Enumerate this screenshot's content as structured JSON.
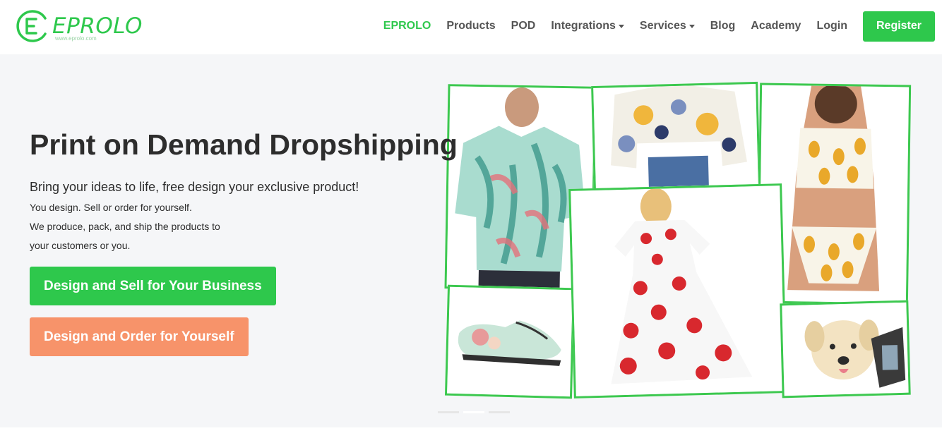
{
  "brand": {
    "name": "EPROLO",
    "url_text": "www.eprolo.com",
    "color": "#2ec84c"
  },
  "nav": {
    "items": [
      {
        "label": "EPROLO",
        "active": true,
        "dropdown": false
      },
      {
        "label": "Products",
        "active": false,
        "dropdown": false
      },
      {
        "label": "POD",
        "active": false,
        "dropdown": false
      },
      {
        "label": "Integrations",
        "active": false,
        "dropdown": true
      },
      {
        "label": "Services",
        "active": false,
        "dropdown": true
      },
      {
        "label": "Blog",
        "active": false,
        "dropdown": false
      },
      {
        "label": "Academy",
        "active": false,
        "dropdown": false
      },
      {
        "label": "Login",
        "active": false,
        "dropdown": false
      }
    ],
    "register_label": "Register"
  },
  "hero": {
    "title": "Print on Demand Dropshipping",
    "lead": "Bring your ideas to life, free design your exclusive product!",
    "lines": [
      "You design. Sell or order for yourself.",
      "We produce, pack, and ship the products to",
      "your customers or you."
    ],
    "primary_button": "Design and Sell for Your Business",
    "secondary_button": "Design and Order for Yourself",
    "colors": {
      "primary": "#2ec84c",
      "secondary": "#f7936a",
      "tile_border": "#3cc84f"
    }
  },
  "collage": {
    "tiles": [
      {
        "name": "floral-shirt-image",
        "subject": "man in floral print shirt"
      },
      {
        "name": "cropped-hoodie-image",
        "subject": "woman in abstract print cropped hoodie"
      },
      {
        "name": "bikini-image",
        "subject": "woman in pineapple print bikini"
      },
      {
        "name": "slip-on-shoe-image",
        "subject": "floral print slip-on shoe"
      },
      {
        "name": "polka-dress-image",
        "subject": "woman in red polka dot dress"
      },
      {
        "name": "dog-harness-image",
        "subject": "dog wearing printed harness"
      }
    ]
  },
  "carousel": {
    "slides": 3,
    "active_slide": 2
  }
}
